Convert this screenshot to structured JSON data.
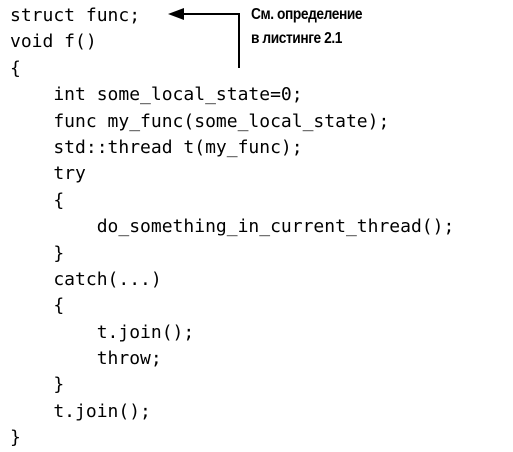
{
  "code_lines": [
    "struct func;",
    "void f()",
    "{",
    "    int some_local_state=0;",
    "    func my_func(some_local_state);",
    "    std::thread t(my_func);",
    "    try",
    "    {",
    "        do_something_in_current_thread();",
    "    }",
    "    catch(...)",
    "    {",
    "        t.join();",
    "        throw;",
    "    }",
    "    t.join();",
    "}"
  ],
  "callout": {
    "line1": "См. определение",
    "line2": "в листинге 2.1"
  }
}
